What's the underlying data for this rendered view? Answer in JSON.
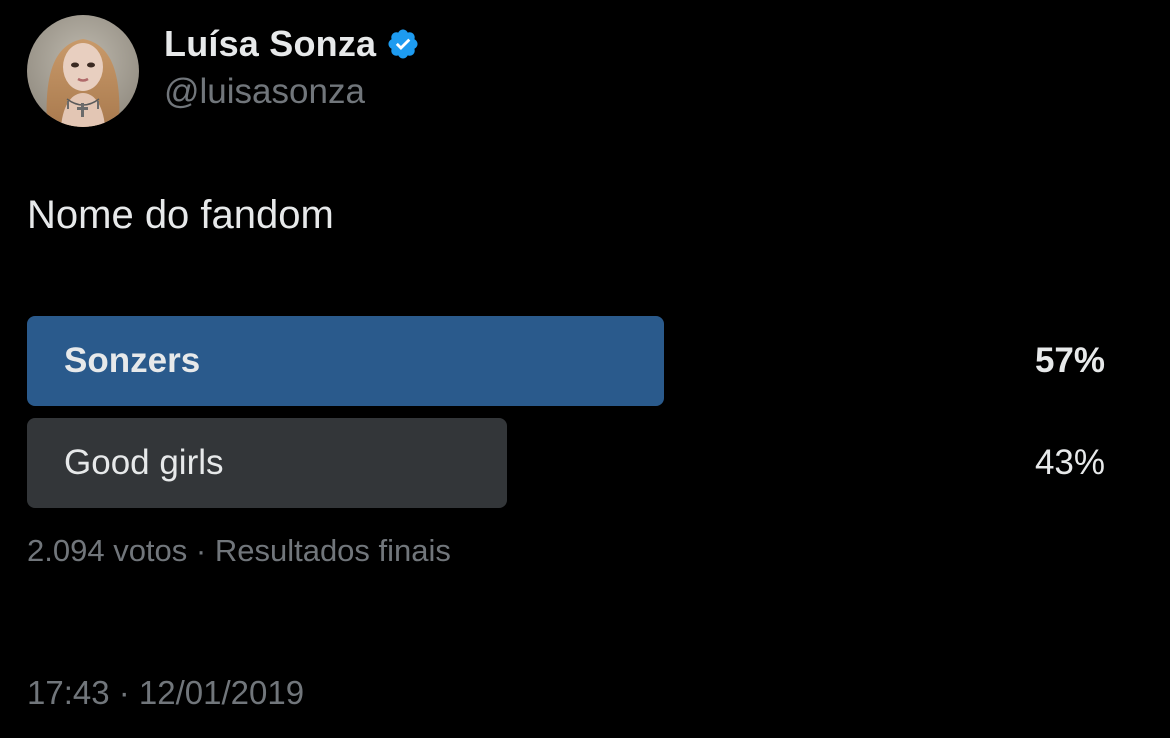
{
  "author": {
    "display_name": "Luísa Sonza",
    "handle": "@luisasonza",
    "verified": true,
    "verified_icon": "verified-badge-icon"
  },
  "tweet": {
    "text": "Nome do fandom"
  },
  "poll": {
    "options": [
      {
        "label": "Sonzers",
        "percent": "57%",
        "fraction": 0.57,
        "winner": true
      },
      {
        "label": "Good girls",
        "percent": "43%",
        "fraction": 0.43,
        "winner": false
      }
    ],
    "meta": "2.094 votos · Resultados finais"
  },
  "timestamp": "17:43 · 12/01/2019",
  "colors": {
    "background": "#000000",
    "winner_bar": "#2a5a8c",
    "loser_bar": "#333639",
    "verified": "#1d9bf0",
    "secondary_text": "#71767b"
  }
}
